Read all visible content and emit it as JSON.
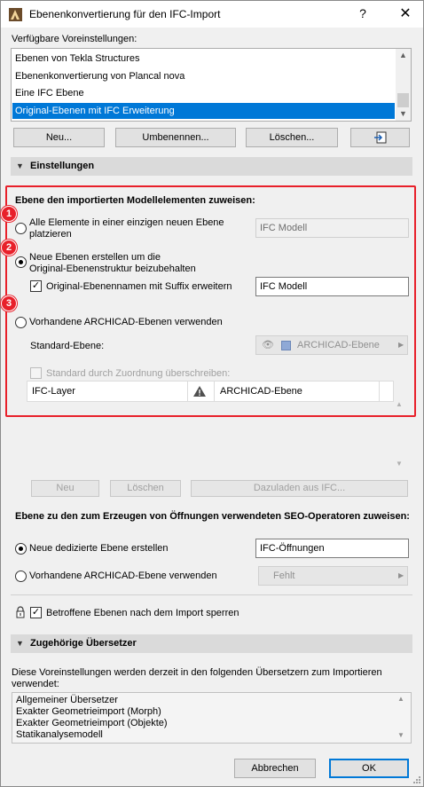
{
  "window": {
    "title": "Ebenenkonvertierung für den IFC-Import",
    "help": "?",
    "close": "✕"
  },
  "presets": {
    "label": "Verfügbare Voreinstellungen:",
    "items": [
      "Ebenen von Tekla Structures",
      "Ebenenkonvertierung von Plancal nova",
      "Eine IFC Ebene",
      "Original-Ebenen mit IFC Erweiterung"
    ],
    "selected": 3,
    "buttons": {
      "new": "Neu...",
      "rename": "Umbenennen...",
      "delete": "Löschen..."
    }
  },
  "settings": {
    "header": "Einstellungen",
    "assign_label": "Ebene den importierten Modellelementen zuweisen:",
    "option1_line1": "Alle Elemente in einer einzigen neuen Ebene",
    "option1_line2": "platzieren",
    "option1_field": "IFC Modell",
    "option2_line1": "Neue Ebenen erstellen um die",
    "option2_line2": "Original-Ebenenstruktur beizubehalten",
    "suffix_label": "Original-Ebenennamen mit Suffix erweitern",
    "suffix_field": "IFC Modell",
    "option3": "Vorhandene ARCHICAD-Ebenen verwenden",
    "standard_label": "Standard-Ebene:",
    "standard_value": "ARCHICAD-Ebene",
    "override_label": "Standard durch Zuordnung überschreiben:",
    "table": {
      "col1": "IFC-Layer",
      "col2": "ARCHICAD-Ebene"
    },
    "markers": [
      "1",
      "2",
      "3"
    ],
    "table_buttons": {
      "new": "Neu",
      "delete": "Löschen",
      "load": "Dazuladen aus IFC..."
    }
  },
  "openings": {
    "label": "Ebene zu den zum Erzeugen von Öffnungen verwendeten SEO-Operatoren zuweisen:",
    "option1": "Neue dedizierte Ebene erstellen",
    "option1_field": "IFC-Öffnungen",
    "option2": "Vorhandene ARCHICAD-Ebene verwenden",
    "option2_value": "Fehlt"
  },
  "lock": {
    "label": "Betroffene Ebenen nach dem Import sperren"
  },
  "translators": {
    "header": "Zugehörige Übersetzer",
    "desc_line1": "Diese Voreinstellungen werden derzeit in den folgenden Übersetzern zum Importieren",
    "desc_line2": "verwendet:",
    "items": [
      "Allgemeiner Übersetzer",
      "Exakter Geometrieimport (Morph)",
      "Exakter Geometrieimport (Objekte)",
      "Statikanalysemodell"
    ]
  },
  "footer": {
    "cancel": "Abbrechen",
    "ok": "OK"
  },
  "colors": {
    "accent": "#0078d7",
    "marker": "#e8202a"
  }
}
